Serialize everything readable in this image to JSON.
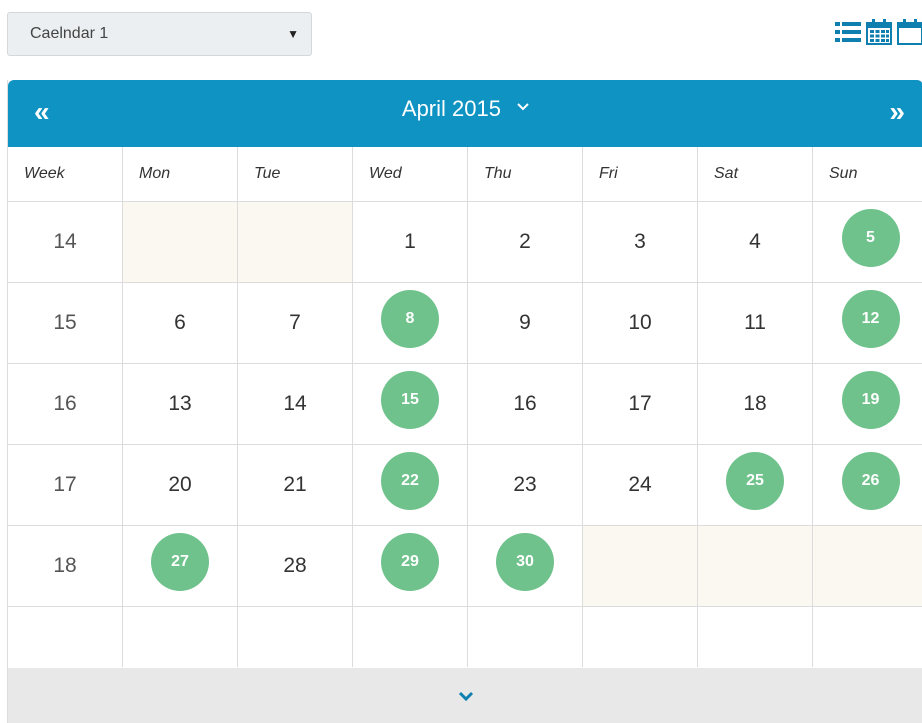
{
  "calendar_select": {
    "value": "Caelndar 1"
  },
  "view_icons": [
    "list-view-icon",
    "month-view-icon",
    "week-view-icon"
  ],
  "header": {
    "prev_label": "«",
    "title": "April 2015",
    "next_label": "»"
  },
  "columns": [
    "Week",
    "Mon",
    "Tue",
    "Wed",
    "Thu",
    "Fri",
    "Sat",
    "Sun"
  ],
  "weeks": [
    {
      "week": "14",
      "days": [
        "",
        "",
        "1",
        "2",
        "3",
        "4",
        "5"
      ]
    },
    {
      "week": "15",
      "days": [
        "6",
        "7",
        "8",
        "9",
        "10",
        "11",
        "12"
      ]
    },
    {
      "week": "16",
      "days": [
        "13",
        "14",
        "15",
        "16",
        "17",
        "18",
        "19"
      ]
    },
    {
      "week": "17",
      "days": [
        "20",
        "21",
        "22",
        "23",
        "24",
        "25",
        "26"
      ]
    },
    {
      "week": "18",
      "days": [
        "27",
        "28",
        "29",
        "30",
        "",
        "",
        ""
      ]
    }
  ],
  "highlighted_days": [
    "5",
    "8",
    "12",
    "15",
    "19",
    "22",
    "25",
    "26",
    "27",
    "29",
    "30"
  ],
  "colors": {
    "header": "#0f93c2",
    "highlight": "#6fc28c",
    "off_day": "#fbf8f2",
    "footer": "#e8e8e8"
  }
}
